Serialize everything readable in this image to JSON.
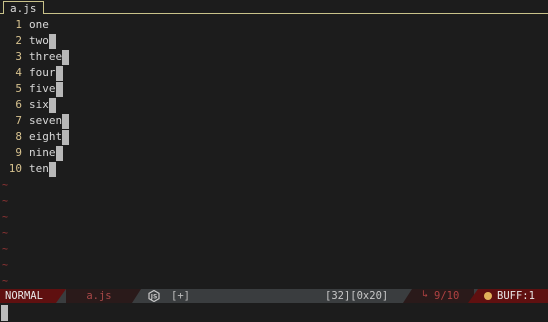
{
  "tabline": {
    "tabs": [
      {
        "label": "a.js"
      }
    ]
  },
  "buffer": {
    "lines": [
      {
        "num": "1",
        "text": "one"
      },
      {
        "num": "2",
        "text": "two"
      },
      {
        "num": "3",
        "text": "three"
      },
      {
        "num": "4",
        "text": "four"
      },
      {
        "num": "5",
        "text": "five"
      },
      {
        "num": "6",
        "text": "six"
      },
      {
        "num": "7",
        "text": "seven"
      },
      {
        "num": "8",
        "text": "eight"
      },
      {
        "num": "9",
        "text": "nine"
      },
      {
        "num": "10",
        "text": "ten"
      }
    ],
    "empty_marker": "~"
  },
  "statusline": {
    "mode": "NORMAL",
    "filename": "a.js",
    "filetype_icon": "nodejs-icon",
    "modified": "[+]",
    "position": "[32][0x20]",
    "line_arrow": "↳",
    "line_info": "9/10",
    "buffer": "BUFF:1"
  },
  "colors": {
    "background": "#1c1c1c",
    "line_number": "#d7c28f",
    "tilde": "#a33838",
    "mode_bg": "#5f1010",
    "statusline_bg": "#3a3d3f",
    "buffer_dot": "#e2b15a"
  }
}
